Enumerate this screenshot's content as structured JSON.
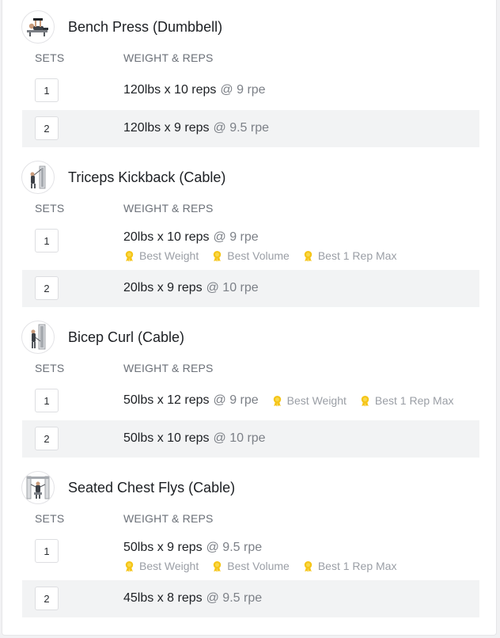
{
  "columns": {
    "sets": "SETS",
    "weight_reps": "WEIGHT & REPS"
  },
  "colors": {
    "medal": "#f5c518",
    "shaded_row": "#f2f3f4",
    "muted_text": "#7c8087"
  },
  "exercises": [
    {
      "title": "Bench Press (Dumbbell)",
      "thumbnail_icon": "bench-press-figure-icon",
      "sets": [
        {
          "number": "1",
          "value": "120lbs x 10 reps",
          "rpe": "@ 9 rpe",
          "prs": []
        },
        {
          "number": "2",
          "value": "120lbs x 9 reps",
          "rpe": "@ 9.5 rpe",
          "prs": []
        }
      ]
    },
    {
      "title": "Triceps Kickback (Cable)",
      "thumbnail_icon": "cable-machine-icon",
      "sets": [
        {
          "number": "1",
          "value": "20lbs x 10 reps",
          "rpe": "@ 9 rpe",
          "prs": [
            "Best Weight",
            "Best Volume",
            "Best 1 Rep Max"
          ]
        },
        {
          "number": "2",
          "value": "20lbs x 9 reps",
          "rpe": "@ 10 rpe",
          "prs": []
        }
      ]
    },
    {
      "title": "Bicep Curl (Cable)",
      "thumbnail_icon": "cable-machine-icon",
      "sets": [
        {
          "number": "1",
          "value": "50lbs x 12 reps",
          "rpe": "@ 9 rpe",
          "prs": [
            "Best Weight",
            "Best 1 Rep Max"
          ]
        },
        {
          "number": "2",
          "value": "50lbs x 10 reps",
          "rpe": "@ 10 rpe",
          "prs": []
        }
      ]
    },
    {
      "title": "Seated Chest Flys (Cable)",
      "thumbnail_icon": "cable-crossover-icon",
      "sets": [
        {
          "number": "1",
          "value": "50lbs x 9 reps",
          "rpe": "@ 9.5 rpe",
          "prs": [
            "Best Weight",
            "Best Volume",
            "Best 1 Rep Max"
          ]
        },
        {
          "number": "2",
          "value": "45lbs x 8 reps",
          "rpe": "@ 9.5 rpe",
          "prs": []
        }
      ]
    }
  ]
}
